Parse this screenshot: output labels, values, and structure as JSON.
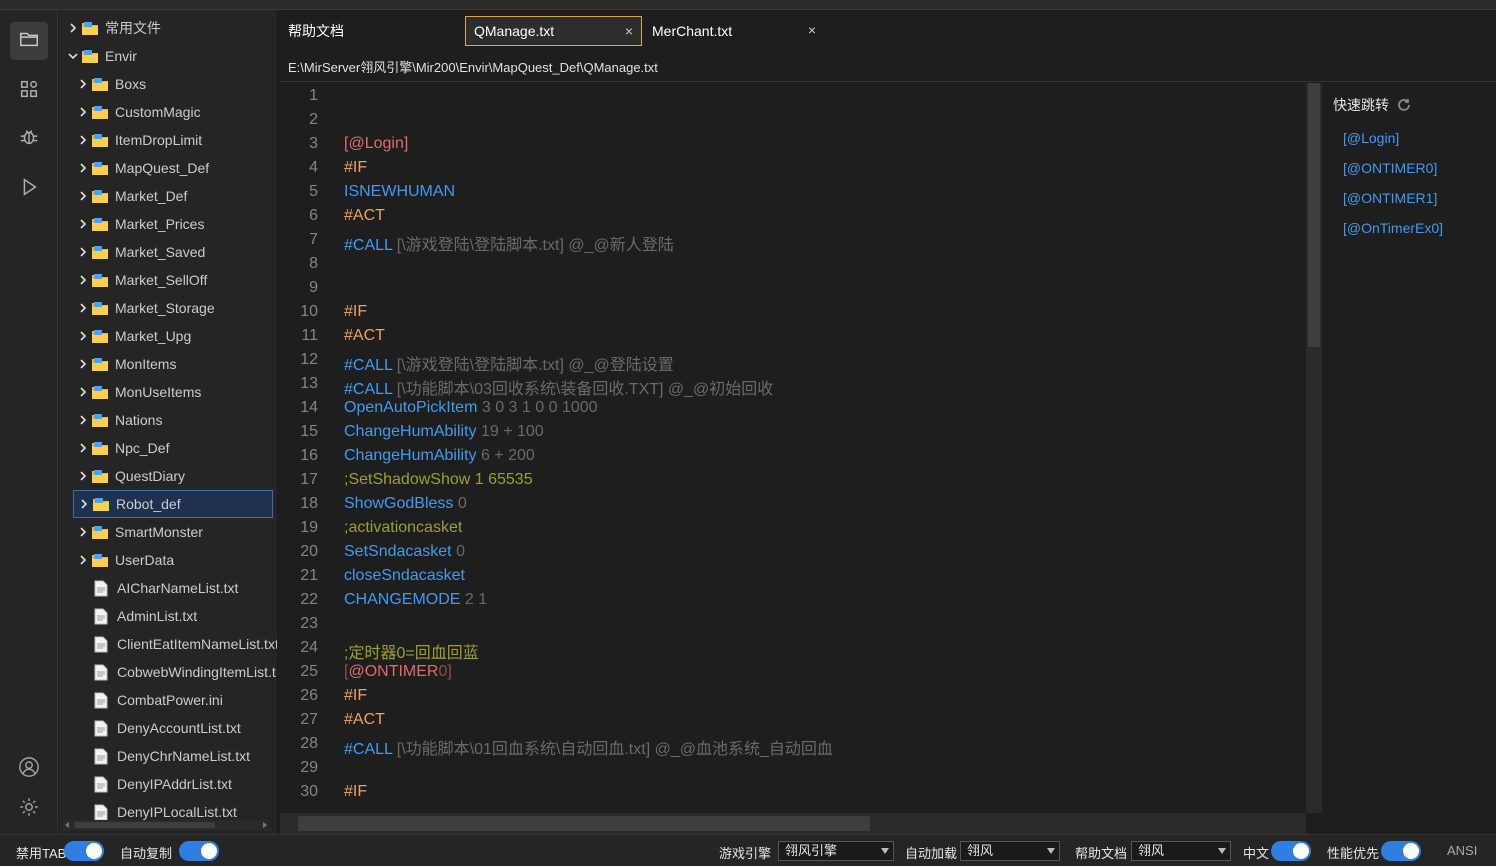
{
  "explorer": {
    "items": [
      {
        "label": "常用文件",
        "kind": "folder",
        "indent": 0,
        "expanded": false
      },
      {
        "label": "Envir",
        "kind": "folder",
        "indent": 0,
        "expanded": true
      },
      {
        "label": "Boxs",
        "kind": "folder",
        "indent": 1,
        "expanded": false
      },
      {
        "label": "CustomMagic",
        "kind": "folder",
        "indent": 1,
        "expanded": false
      },
      {
        "label": "ItemDropLimit",
        "kind": "folder",
        "indent": 1,
        "expanded": false
      },
      {
        "label": "MapQuest_Def",
        "kind": "folder",
        "indent": 1,
        "expanded": false
      },
      {
        "label": "Market_Def",
        "kind": "folder",
        "indent": 1,
        "expanded": false
      },
      {
        "label": "Market_Prices",
        "kind": "folder",
        "indent": 1,
        "expanded": false
      },
      {
        "label": "Market_Saved",
        "kind": "folder",
        "indent": 1,
        "expanded": false
      },
      {
        "label": "Market_SellOff",
        "kind": "folder",
        "indent": 1,
        "expanded": false
      },
      {
        "label": "Market_Storage",
        "kind": "folder",
        "indent": 1,
        "expanded": false
      },
      {
        "label": "Market_Upg",
        "kind": "folder",
        "indent": 1,
        "expanded": false
      },
      {
        "label": "MonItems",
        "kind": "folder",
        "indent": 1,
        "expanded": false
      },
      {
        "label": "MonUseItems",
        "kind": "folder",
        "indent": 1,
        "expanded": false
      },
      {
        "label": "Nations",
        "kind": "folder",
        "indent": 1,
        "expanded": false
      },
      {
        "label": "Npc_Def",
        "kind": "folder",
        "indent": 1,
        "expanded": false
      },
      {
        "label": "QuestDiary",
        "kind": "folder",
        "indent": 1,
        "expanded": false
      },
      {
        "label": "Robot_def",
        "kind": "folder",
        "indent": 1,
        "expanded": false,
        "selected": true
      },
      {
        "label": "SmartMonster",
        "kind": "folder",
        "indent": 1,
        "expanded": false
      },
      {
        "label": "UserData",
        "kind": "folder",
        "indent": 1,
        "expanded": false
      },
      {
        "label": "AICharNameList.txt",
        "kind": "file",
        "indent": 1
      },
      {
        "label": "AdminList.txt",
        "kind": "file",
        "indent": 1
      },
      {
        "label": "ClientEatItemNameList.txt",
        "kind": "file",
        "indent": 1
      },
      {
        "label": "CobwebWindingItemList.t",
        "kind": "file",
        "indent": 1
      },
      {
        "label": "CombatPower.ini",
        "kind": "file",
        "indent": 1
      },
      {
        "label": "DenyAccountList.txt",
        "kind": "file",
        "indent": 1
      },
      {
        "label": "DenyChrNameList.txt",
        "kind": "file",
        "indent": 1
      },
      {
        "label": "DenyIPAddrList.txt",
        "kind": "file",
        "indent": 1
      },
      {
        "label": "DenyIPLocalList.txt",
        "kind": "file",
        "indent": 1
      }
    ]
  },
  "tabs": [
    {
      "label": "帮助文档",
      "active": false,
      "closable": false
    },
    {
      "label": "QManage.txt",
      "active": true,
      "closable": true
    },
    {
      "label": "MerChant.txt",
      "active": false,
      "closable": true
    }
  ],
  "close_glyph": "×",
  "path": "E:\\MirServer翎风引擎\\Mir200\\Envir\\MapQuest_Def\\QManage.txt",
  "editor": {
    "lines": [
      {
        "n": "1",
        "parts": []
      },
      {
        "n": "2",
        "parts": []
      },
      {
        "n": "3",
        "parts": [
          {
            "t": "[@Login]",
            "c": "label"
          }
        ]
      },
      {
        "n": "4",
        "parts": [
          {
            "t": "#IF",
            "c": "kw"
          }
        ]
      },
      {
        "n": "5",
        "parts": [
          {
            "t": "ISNEWHUMAN",
            "c": "fn"
          }
        ]
      },
      {
        "n": "6",
        "parts": [
          {
            "t": "#ACT",
            "c": "kw"
          }
        ]
      },
      {
        "n": "7",
        "parts": [
          {
            "t": "#CALL",
            "c": "fn"
          },
          {
            "t": " [\\游戏登陆\\登陆脚本.txt] @_@新人登陆",
            "c": "arg"
          }
        ]
      },
      {
        "n": "8",
        "parts": []
      },
      {
        "n": "9",
        "parts": []
      },
      {
        "n": "10",
        "parts": [
          {
            "t": "#IF",
            "c": "kw"
          }
        ]
      },
      {
        "n": "11",
        "parts": [
          {
            "t": "#ACT",
            "c": "kw"
          }
        ]
      },
      {
        "n": "12",
        "parts": [
          {
            "t": "#CALL",
            "c": "fn"
          },
          {
            "t": " [\\游戏登陆\\登陆脚本.txt] @_@登陆设置",
            "c": "arg"
          }
        ]
      },
      {
        "n": "13",
        "parts": [
          {
            "t": "#CALL",
            "c": "fn"
          },
          {
            "t": " [\\功能脚本\\03回收系统\\装备回收.TXT] @_@初始回收",
            "c": "arg"
          }
        ]
      },
      {
        "n": "14",
        "parts": [
          {
            "t": "OpenAutoPickItem",
            "c": "fn"
          },
          {
            "t": " 3 0 3 1 0 0 1000",
            "c": "arg"
          }
        ]
      },
      {
        "n": "15",
        "parts": [
          {
            "t": "ChangeHumAbility",
            "c": "fn"
          },
          {
            "t": " 19 + 100",
            "c": "arg"
          }
        ]
      },
      {
        "n": "16",
        "parts": [
          {
            "t": "ChangeHumAbility",
            "c": "fn"
          },
          {
            "t": " 6 + 200",
            "c": "arg"
          }
        ]
      },
      {
        "n": "17",
        "parts": [
          {
            "t": ";SetShadowShow 1 65535",
            "c": "comment"
          }
        ]
      },
      {
        "n": "18",
        "parts": [
          {
            "t": "ShowGodBless",
            "c": "fn"
          },
          {
            "t": " 0",
            "c": "arg"
          }
        ]
      },
      {
        "n": "19",
        "parts": [
          {
            "t": ";activationcasket",
            "c": "comment"
          }
        ]
      },
      {
        "n": "20",
        "parts": [
          {
            "t": "SetSndacasket",
            "c": "fn"
          },
          {
            "t": " 0",
            "c": "arg"
          }
        ]
      },
      {
        "n": "21",
        "parts": [
          {
            "t": "closeSndacasket",
            "c": "fn"
          }
        ]
      },
      {
        "n": "22",
        "parts": [
          {
            "t": "CHANGEMODE",
            "c": "fn"
          },
          {
            "t": " 2 1",
            "c": "arg"
          }
        ]
      },
      {
        "n": "23",
        "parts": []
      },
      {
        "n": "24",
        "parts": [
          {
            "t": ";定时器0=回血回蓝",
            "c": "comment"
          }
        ]
      },
      {
        "n": "25",
        "parts": [
          {
            "t": "[",
            "c": "label-dim"
          },
          {
            "t": "@ONTIMER",
            "c": "label"
          },
          {
            "t": "0]",
            "c": "label-dim"
          }
        ]
      },
      {
        "n": "26",
        "parts": [
          {
            "t": "#IF",
            "c": "kw"
          }
        ]
      },
      {
        "n": "27",
        "parts": [
          {
            "t": "#ACT",
            "c": "kw"
          }
        ]
      },
      {
        "n": "28",
        "parts": [
          {
            "t": "#CALL",
            "c": "fn"
          },
          {
            "t": " [\\功能脚本\\01回血系统\\自动回血.txt] @_@血池系统_自动回血",
            "c": "arg"
          }
        ]
      },
      {
        "n": "29",
        "parts": []
      },
      {
        "n": "30",
        "parts": [
          {
            "t": "#IF",
            "c": "kw"
          }
        ]
      }
    ]
  },
  "quick_jump": {
    "title": "快速跳转",
    "items": [
      "[@Login]",
      "[@ONTIMER0]",
      "[@ONTIMER1]",
      "[@OnTimerEx0]"
    ]
  },
  "status": {
    "disable_tab_label": "禁用TAB",
    "auto_copy_label": "自动复制",
    "engine_label": "游戏引擎",
    "engine_value": "翎风引擎",
    "autoload_label": "自动加载",
    "autoload_value": "翎风",
    "helpdoc_label": "帮助文档",
    "helpdoc_value": "翎风",
    "chinese_label": "中文",
    "perf_label": "性能优先",
    "encoding": "ANSI"
  },
  "colors": {
    "accent": "#2f7ee0",
    "tab_active_border": "#d7a94a",
    "label": "#e06c6c",
    "keyword": "#f0a35a",
    "function": "#3f9cf0",
    "comment": "#a0a020"
  }
}
